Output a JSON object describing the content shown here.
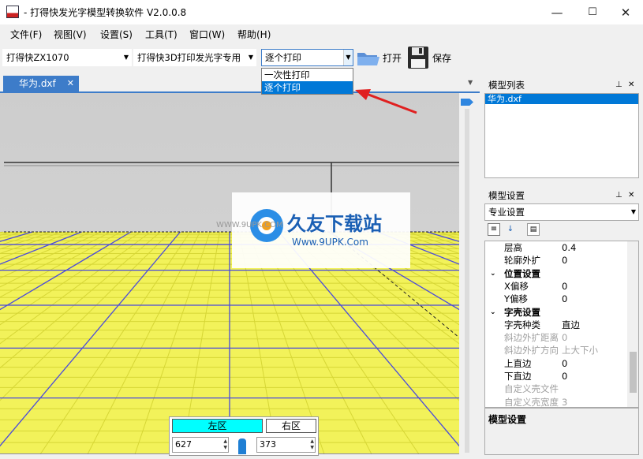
{
  "window": {
    "title": "- 打得快发光字模型转换软件 V2.0.0.8",
    "min": "—",
    "max": "☐",
    "close": "✕"
  },
  "menu": [
    "文件(F)",
    "视图(V)",
    "设置(S)",
    "工具(T)",
    "窗口(W)",
    "帮助(H)"
  ],
  "toolbar": {
    "machine": "打得快ZX1070",
    "printer_type": "打得快3D打印发光字专用",
    "print_mode": "逐个打印",
    "open_label": "打开",
    "save_label": "保存"
  },
  "dropdown": {
    "options": [
      "一次性打印",
      "逐个打印"
    ],
    "selected_index": 1
  },
  "document": {
    "tab_label": "华为.dxf",
    "close": "✕"
  },
  "model_list": {
    "title": "模型列表",
    "items": [
      "华为.dxf"
    ],
    "pin": "⊥",
    "close": "✕"
  },
  "model_settings": {
    "title": "模型设置",
    "mode": "专业设置",
    "rows": [
      {
        "key": "层高",
        "value": "0.4",
        "kind": "prop"
      },
      {
        "key": "轮廓外扩",
        "value": "0",
        "kind": "prop"
      },
      {
        "key": "位置设置",
        "value": "",
        "kind": "cat"
      },
      {
        "key": "X偏移",
        "value": "0",
        "kind": "prop"
      },
      {
        "key": "Y偏移",
        "value": "0",
        "kind": "prop"
      },
      {
        "key": "字壳设置",
        "value": "",
        "kind": "cat"
      },
      {
        "key": "字壳种类",
        "value": "直边",
        "kind": "prop"
      },
      {
        "key": "斜边外扩距离",
        "value": "0",
        "kind": "dis"
      },
      {
        "key": "斜边外扩方向",
        "value": "上大下小",
        "kind": "dis"
      },
      {
        "key": "上直边",
        "value": "0",
        "kind": "prop"
      },
      {
        "key": "下直边",
        "value": "0",
        "kind": "prop"
      },
      {
        "key": "自定义壳文件",
        "value": "",
        "kind": "dis"
      },
      {
        "key": "自定义壳宽度",
        "value": "3",
        "kind": "dis"
      }
    ],
    "description_title": "模型设置"
  },
  "zones": {
    "left_label": "左区",
    "right_label": "右区",
    "left_value": "627",
    "right_value": "373"
  },
  "watermark": {
    "brand": "久友下载站",
    "url": "WWW.9UPK.COM",
    "url2": "Www.9UPK.Com"
  },
  "colors": {
    "accent": "#3d7cc9",
    "grid_yellow": "#f2f25a",
    "grid_blue": "#4a4adc",
    "zone_cyan": "#00ffff",
    "arrow_red": "#e02020"
  }
}
